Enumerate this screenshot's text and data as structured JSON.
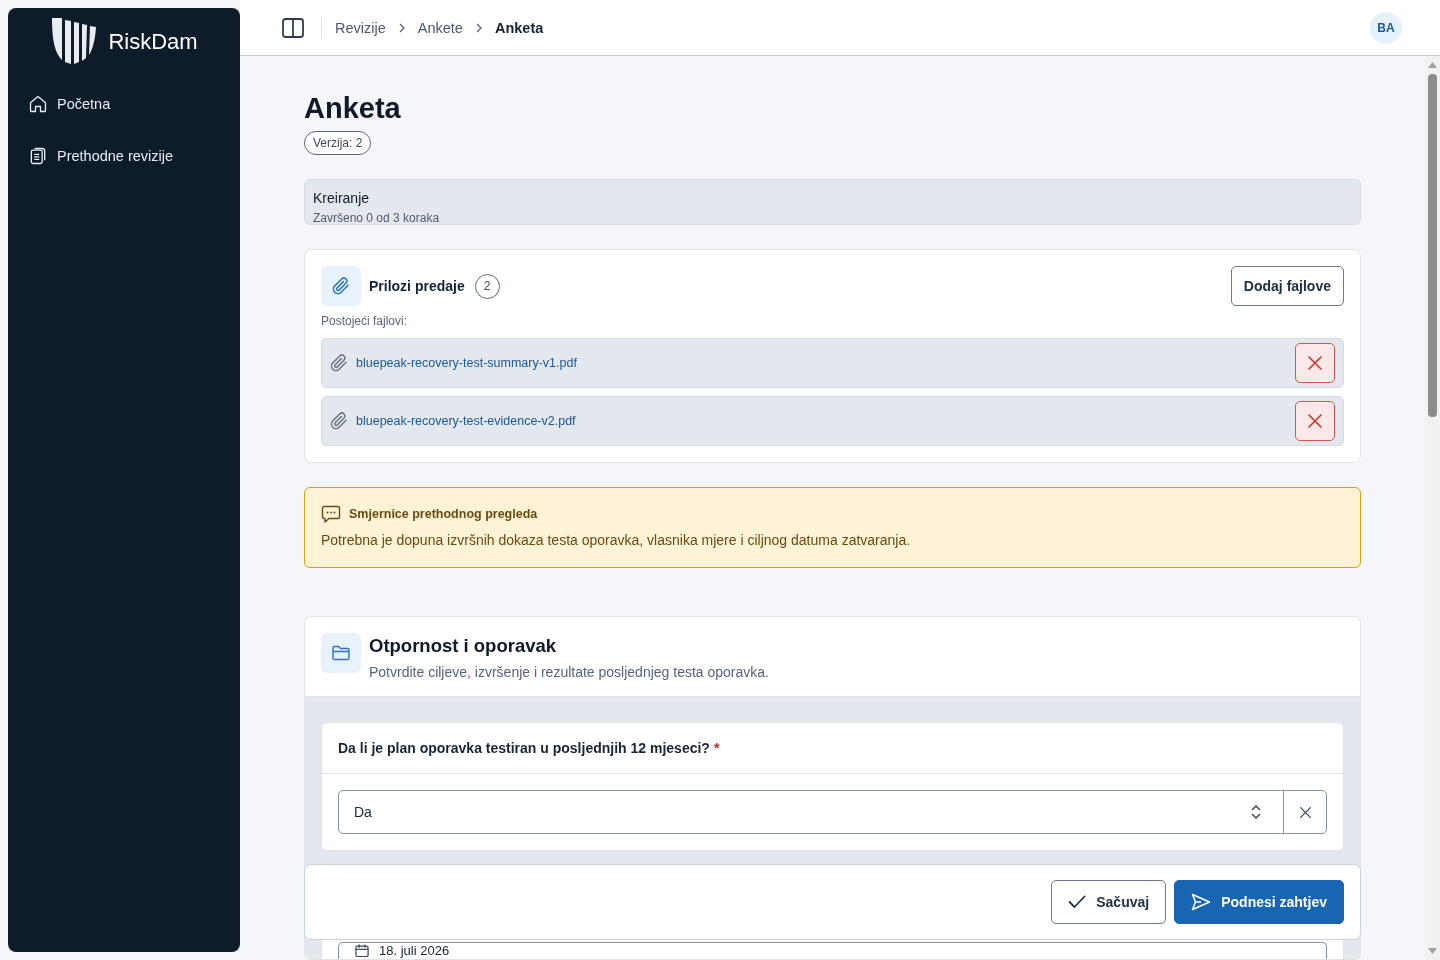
{
  "sidebar": {
    "brand": "RiskDam",
    "items": [
      {
        "label": "Početna",
        "kind": "home"
      },
      {
        "label": "Prethodne revizije",
        "kind": "clipboard"
      }
    ]
  },
  "header": {
    "breadcrumbs": [
      {
        "label": "Revizije",
        "current": false
      },
      {
        "label": "Ankete",
        "current": false
      },
      {
        "label": "Anketa",
        "current": true
      }
    ],
    "avatar": "BA"
  },
  "page": {
    "title": "Anketa",
    "version": "Verzija: 2"
  },
  "progress": {
    "title": "Kreiranje",
    "subtitle": "Završeno 0 od 3 koraka"
  },
  "attachments": {
    "title": "Prilozi predaje",
    "count": "2",
    "add_button": "Dodaj fajlove",
    "list_label": "Postojeći fajlovi:",
    "files": [
      "bluepeak-recovery-test-summary-v1.pdf",
      "bluepeak-recovery-test-evidence-v2.pdf"
    ]
  },
  "alert": {
    "title": "Smjernice prethodnog pregleda",
    "text": "Potrebna je dopuna izvršnih dokaza testa oporavka, vlasnika mjere i ciljnog datuma zatvaranja."
  },
  "section": {
    "title": "Otpornost i oporavak",
    "description": "Potvrdite ciljeve, izvršenje i rezultate posljednjeg testa oporavka.",
    "questions": [
      {
        "kind": "select",
        "label": "Da li je plan oporavka testiran u posljednjih 12 mjeseci?",
        "required_mark": "*",
        "value": "Da"
      },
      {
        "kind": "date",
        "value": "18. juli 2026"
      }
    ]
  },
  "actions": {
    "save": "Sačuvaj",
    "submit": "Podnesi zahtjev"
  }
}
